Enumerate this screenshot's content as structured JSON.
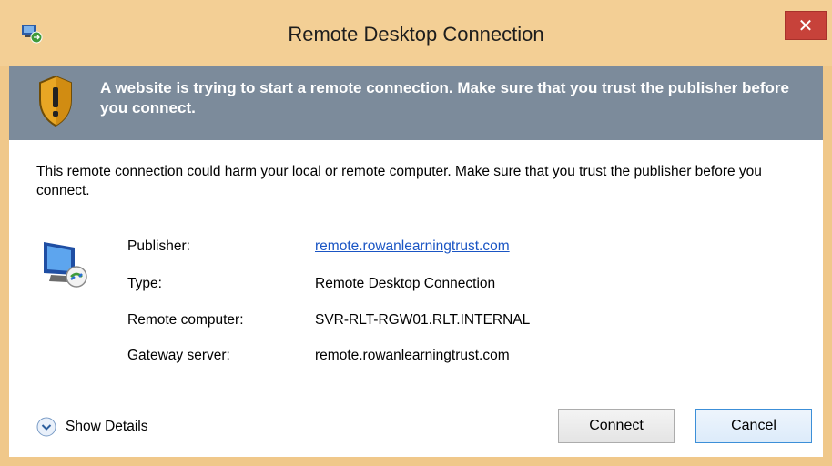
{
  "window": {
    "title": "Remote Desktop Connection",
    "close_glyph": "✕",
    "frame_color": "#f3cf95",
    "close_color": "#c7423a"
  },
  "banner": {
    "text": "A website is trying to start a remote connection. Make sure that you trust the publisher before you connect.",
    "color": "#7c8b9b",
    "icon": "warning-shield-icon"
  },
  "warning": {
    "text": "This remote connection could harm your local or remote computer. Make sure that you trust the publisher before you connect."
  },
  "details": {
    "icon": "remote-computer-icon",
    "rows": [
      {
        "label": "Publisher:",
        "value": "remote.rowanlearningtrust.com"
      },
      {
        "label": "Type:",
        "value": "Remote Desktop Connection"
      },
      {
        "label": "Remote computer:",
        "value": "SVR-RLT-RGW01.RLT.INTERNAL"
      },
      {
        "label": "Gateway server:",
        "value": "remote.rowanlearningtrust.com"
      }
    ]
  },
  "footer": {
    "show_details_label": "Show Details",
    "connect_label": "Connect",
    "cancel_label": "Cancel"
  }
}
